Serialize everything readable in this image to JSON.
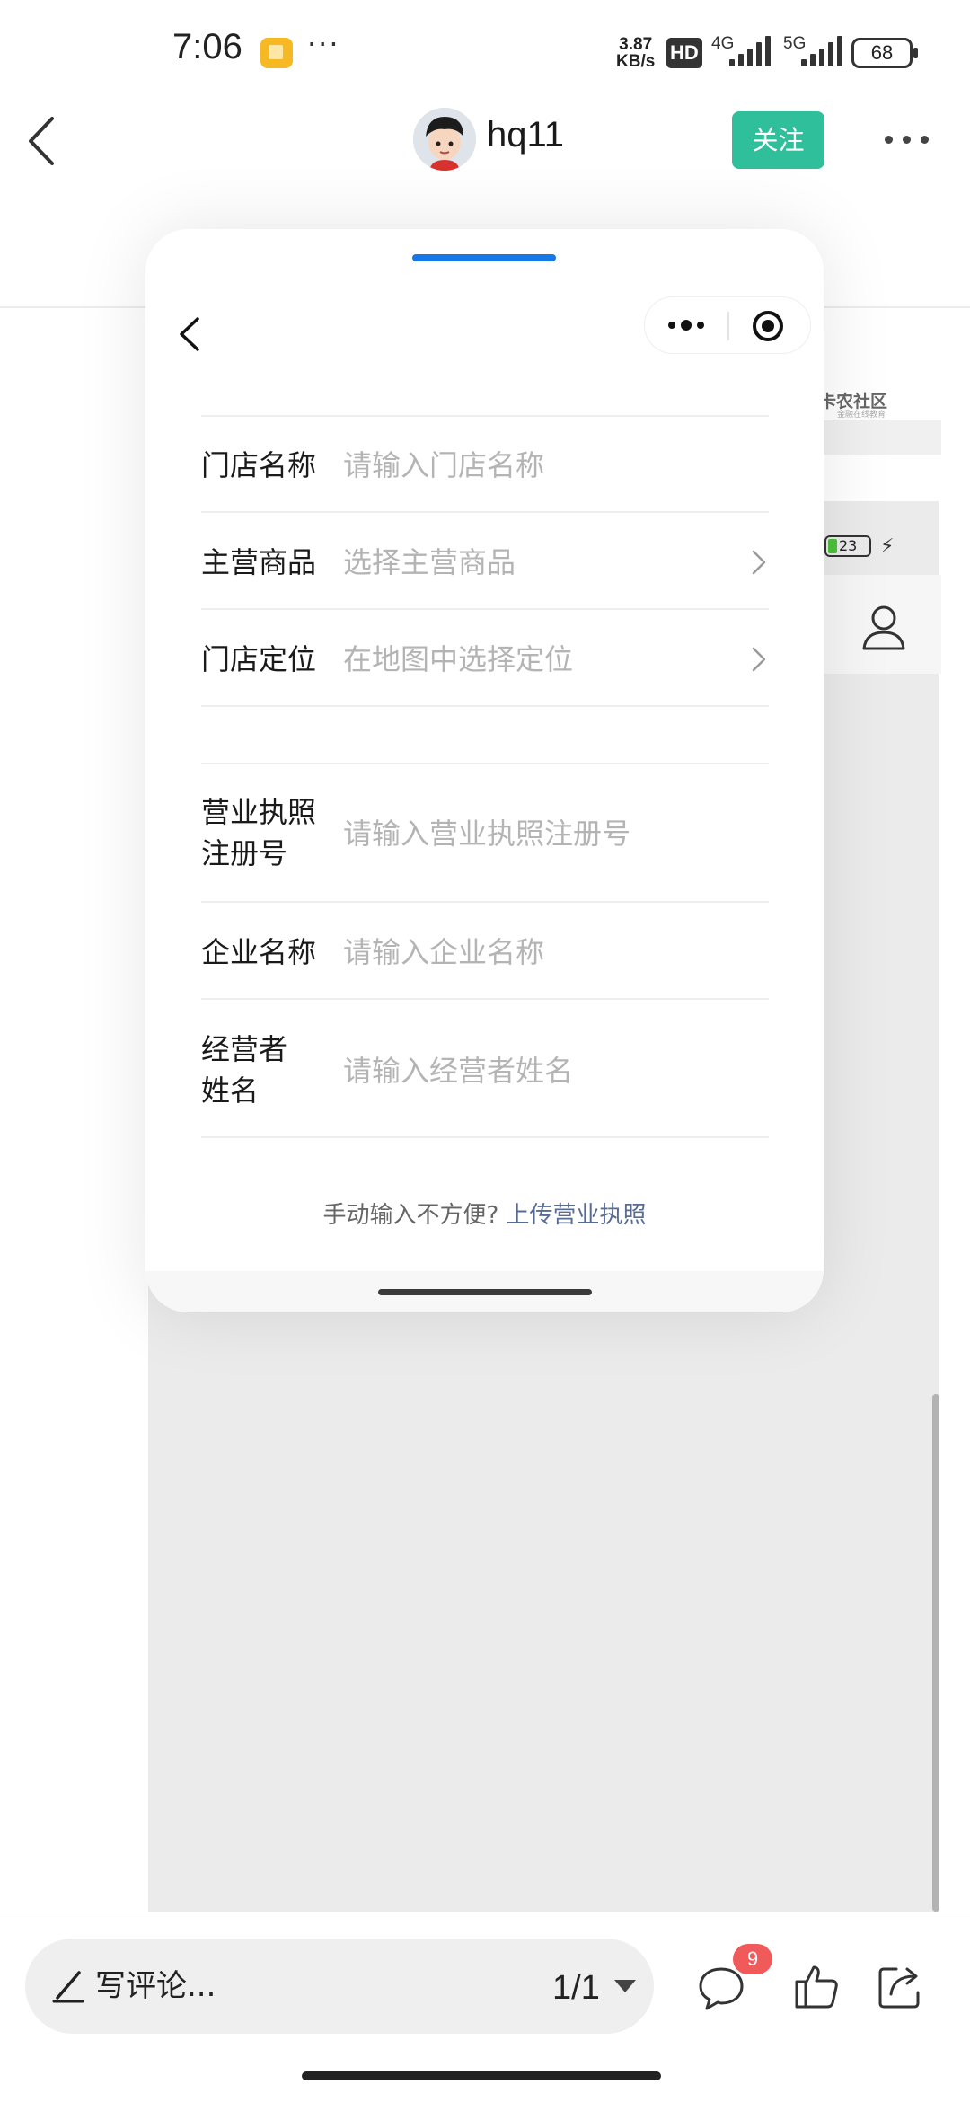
{
  "status_bar": {
    "time": "7:06",
    "more": "···",
    "speed_value": "3.87",
    "speed_unit": "KB/s",
    "hd": "HD",
    "net_1": "4G",
    "net_2": "5G",
    "battery": "68"
  },
  "header": {
    "username": "hq11",
    "follow_label": "关注"
  },
  "background": {
    "brand": "卡农社区",
    "brand_sub": "金融在线教育",
    "battery": "23"
  },
  "mini_program": {
    "form": {
      "store_name": {
        "label": "门店名称",
        "placeholder": "请输入门店名称"
      },
      "main_products": {
        "label": "主营商品",
        "placeholder": "选择主营商品"
      },
      "store_location": {
        "label": "门店定位",
        "placeholder": "在地图中选择定位"
      },
      "license_number": {
        "label_line1": "营业执照",
        "label_line2": "注册号",
        "placeholder": "请输入营业执照注册号"
      },
      "company_name": {
        "label": "企业名称",
        "placeholder": "请输入企业名称"
      },
      "operator_name": {
        "label_line1": "经营者",
        "label_line2": "姓名",
        "placeholder": "请输入经营者姓名"
      }
    },
    "footer": {
      "prompt": "手动输入不方便?",
      "link": "上传营业执照"
    }
  },
  "bottom_bar": {
    "comment_placeholder": "写评论...",
    "page_indicator": "1/1",
    "comment_badge": "9"
  },
  "colors": {
    "follow": "#2fbf9b",
    "indicator": "#1677e6",
    "link": "#576b95",
    "badge": "#f05a5a"
  }
}
